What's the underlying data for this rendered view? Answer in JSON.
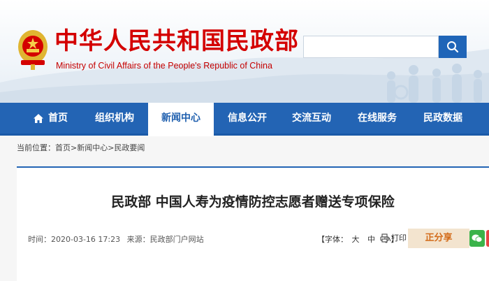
{
  "header": {
    "title_cn": "中华人民共和国民政部",
    "title_en": "Ministry of Civil Affairs of the People's Republic of China",
    "search_placeholder": ""
  },
  "nav": {
    "items": [
      {
        "label": "首页",
        "active": false
      },
      {
        "label": "组织机构",
        "active": false
      },
      {
        "label": "新闻中心",
        "active": true
      },
      {
        "label": "信息公开",
        "active": false
      },
      {
        "label": "交流互动",
        "active": false
      },
      {
        "label": "在线服务",
        "active": false
      },
      {
        "label": "民政数据",
        "active": false
      }
    ]
  },
  "breadcrumb": {
    "prefix": "当前位置：",
    "items": [
      "首页",
      "新闻中心",
      "民政要闻"
    ],
    "separator": ">"
  },
  "article": {
    "title": "民政部 中国人寿为疫情防控志愿者赠送专项保险",
    "time_label": "时间：",
    "time_value": "2020-03-16 17:23",
    "source_label": "来源：",
    "source_value": "民政部门户网站",
    "fontsize_label": "【字体：",
    "fontsize_large": "大",
    "fontsize_medium": "中",
    "fontsize_small": "小",
    "fontsize_close": "】",
    "print_label": "打印",
    "share_label": "正分享"
  },
  "colors": {
    "nav_blue": "#2364b4",
    "title_red": "#d40000",
    "share_bg": "#f3e4cf",
    "share_text": "#d36b1a"
  }
}
